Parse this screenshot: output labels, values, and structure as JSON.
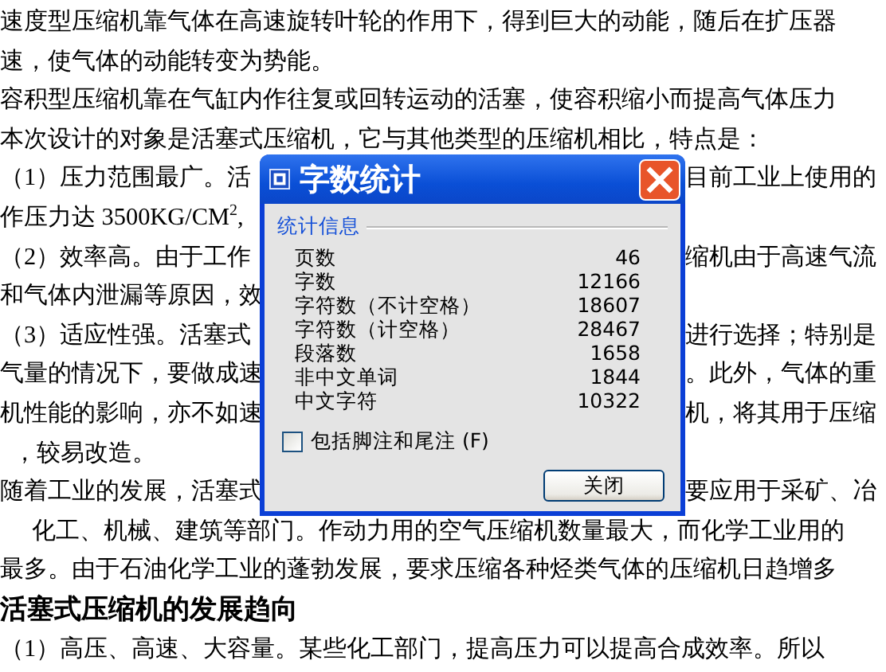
{
  "document": {
    "lines": [
      {
        "kind": "text",
        "text": "速度型压缩机靠气体在高速旋转叶轮的作用下，得到巨大的动能，随后在扩压器"
      },
      {
        "kind": "text",
        "text": "速，使气体的动能转变为势能。"
      },
      {
        "kind": "text",
        "text": "容积型压缩机靠在气缸内作往复或回转运动的活塞，使容积缩小而提高气体压力"
      },
      {
        "kind": "text",
        "text": "本次设计的对象是活塞式压缩机，它与其他类型的压缩机相比，特点是："
      },
      {
        "kind": "split",
        "left": "（1）压力范围最广。活",
        "right": "目前工业上使用的"
      },
      {
        "kind": "split",
        "left": "作压力达 3500KG/CM$^{2}$,"
      },
      {
        "kind": "split",
        "left": "（2）效率高。由于工作",
        "right": "缩机由于高速气流"
      },
      {
        "kind": "split",
        "left": "和气体内泄漏等原因，效"
      },
      {
        "kind": "split",
        "left": "（3）适应性强。活塞式",
        "right": "进行选择；特别是"
      },
      {
        "kind": "split",
        "left": "气量的情况下，要做成速",
        "right": "。此外，气体的重"
      },
      {
        "kind": "split",
        "left": "机性能的影响，亦不如速",
        "right": "机，将其用于压缩"
      },
      {
        "kind": "split",
        "left": "，较易改造。"
      },
      {
        "kind": "split",
        "left": "随着工业的发展，活塞式",
        "right": "要应用于采矿、冶"
      },
      {
        "kind": "text",
        "text": "化工、机械、建筑等部门。作动力用的空气压缩机数量最大，而化学工业用的"
      },
      {
        "kind": "text",
        "text": "最多。由于石油化学工业的蓬勃发展，要求压缩各种烃类气体的压缩机日趋增多"
      },
      {
        "kind": "heading",
        "text": "活塞式压缩机的发展趋向"
      },
      {
        "kind": "text",
        "text": "（1）高压、高速、大容量。某些化工部门，提高压力可以提高合成效率。所以"
      }
    ]
  },
  "dialog": {
    "title": "字数统计",
    "group_label": "统计信息",
    "stats": [
      {
        "label": "页数",
        "value": "46"
      },
      {
        "label": "字数",
        "value": "12166"
      },
      {
        "label": "字符数（不计空格）",
        "value": "18607"
      },
      {
        "label": "字符数（计空格）",
        "value": "28467"
      },
      {
        "label": "段落数",
        "value": "1658"
      },
      {
        "label": "非中文单词",
        "value": "1844"
      },
      {
        "label": "中文字符",
        "value": "10322"
      }
    ],
    "checkbox": {
      "label": "包括脚注和尾注 (F)",
      "checked": false
    },
    "button": "关闭"
  }
}
